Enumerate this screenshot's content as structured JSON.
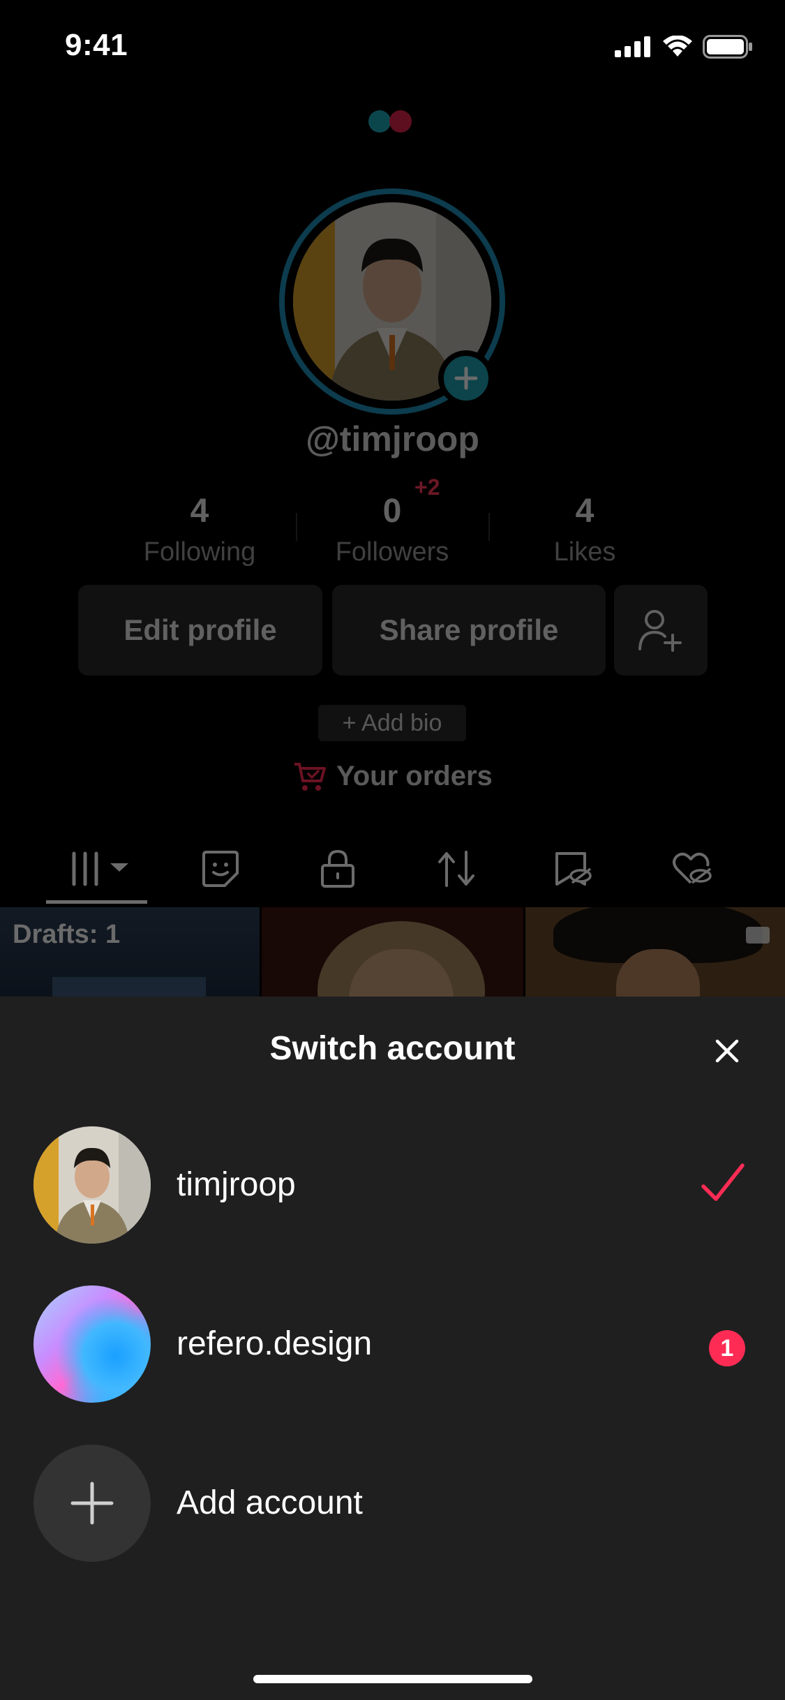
{
  "status_bar": {
    "time": "9:41"
  },
  "profile": {
    "username": "@timjroop",
    "stats": [
      {
        "value": "4",
        "label": "Following"
      },
      {
        "value": "0",
        "label": "Followers",
        "delta": "+2"
      },
      {
        "value": "4",
        "label": "Likes"
      }
    ],
    "buttons": {
      "edit": "Edit profile",
      "share": "Share profile"
    },
    "add_bio": "+ Add bio",
    "orders": "Your orders",
    "drafts": "Drafts: 1"
  },
  "sheet": {
    "title": "Switch account",
    "accounts": [
      {
        "name": "timjroop",
        "status": "selected"
      },
      {
        "name": "refero.design",
        "badge": "1"
      }
    ],
    "add_account": "Add account"
  },
  "colors": {
    "accent": "#fe2c55",
    "ring": "#1d8fb8",
    "sheet_bg": "#1f1f1f"
  }
}
